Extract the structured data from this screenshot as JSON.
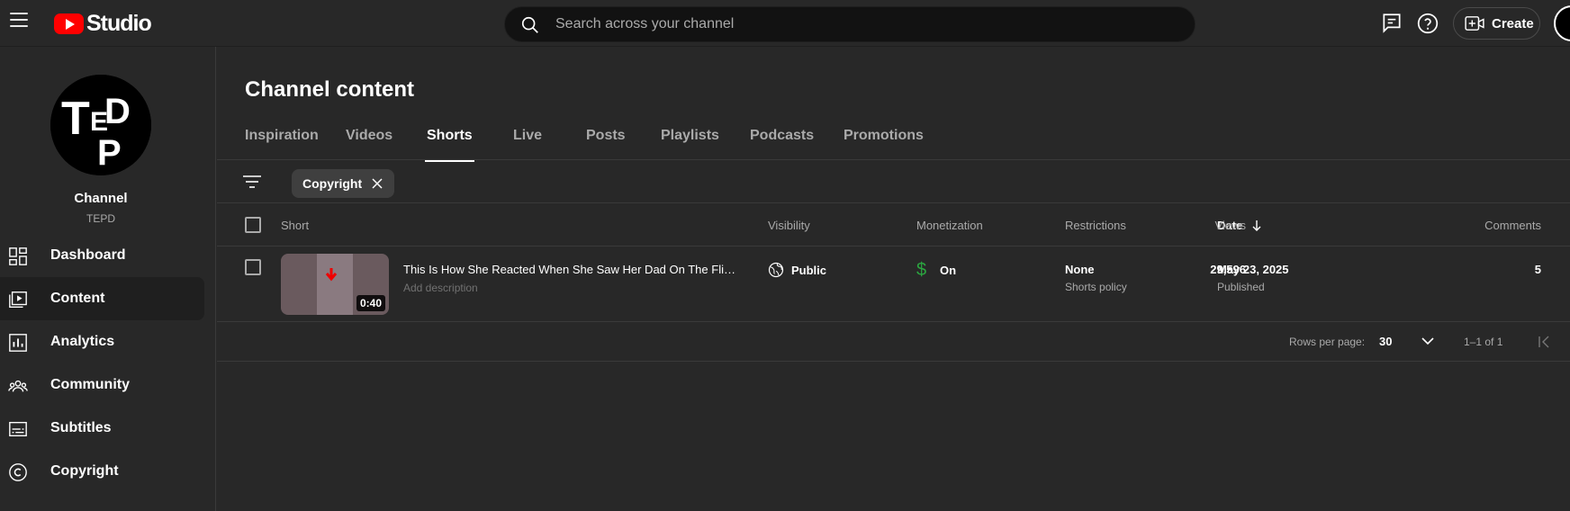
{
  "header": {
    "logo_text": "Studio",
    "search_placeholder": "Search across your channel",
    "create_label": "Create"
  },
  "sidebar": {
    "channel_label": "Channel",
    "channel_name": "TEPD",
    "avatar_letters": [
      "T",
      "E",
      "D",
      "P"
    ],
    "items": [
      {
        "label": "Dashboard",
        "icon": "dashboard-icon"
      },
      {
        "label": "Content",
        "icon": "content-icon",
        "active": true
      },
      {
        "label": "Analytics",
        "icon": "analytics-icon"
      },
      {
        "label": "Community",
        "icon": "community-icon"
      },
      {
        "label": "Subtitles",
        "icon": "subtitles-icon"
      },
      {
        "label": "Copyright",
        "icon": "copyright-icon"
      }
    ]
  },
  "main": {
    "title": "Channel content",
    "tabs": [
      {
        "label": "Inspiration"
      },
      {
        "label": "Videos"
      },
      {
        "label": "Shorts",
        "active": true
      },
      {
        "label": "Live"
      },
      {
        "label": "Posts"
      },
      {
        "label": "Playlists"
      },
      {
        "label": "Podcasts"
      },
      {
        "label": "Promotions"
      }
    ],
    "filter_chip": "Copyright",
    "columns": {
      "short": "Short",
      "visibility": "Visibility",
      "monetization": "Monetization",
      "restrictions": "Restrictions",
      "date": "Date",
      "views": "Views",
      "comments": "Comments"
    },
    "rows": [
      {
        "title": "This Is How She Reacted When She Saw Her Dad On The Flight...",
        "description": "Add description",
        "duration": "0:40",
        "visibility": "Public",
        "monetization": "On",
        "restriction": "None",
        "restriction_detail": "Shorts policy",
        "date": "May 23, 2025",
        "date_status": "Published",
        "views": "29,596",
        "comments": "5"
      }
    ],
    "pagination": {
      "rows_per_page_label": "Rows per page:",
      "rows_per_page": "30",
      "range": "1–1 of 1"
    }
  },
  "colors": {
    "background": "#282828",
    "accent_red": "#ff0000",
    "monetization_green": "#2ba640",
    "muted_text": "#aaaaaa"
  }
}
